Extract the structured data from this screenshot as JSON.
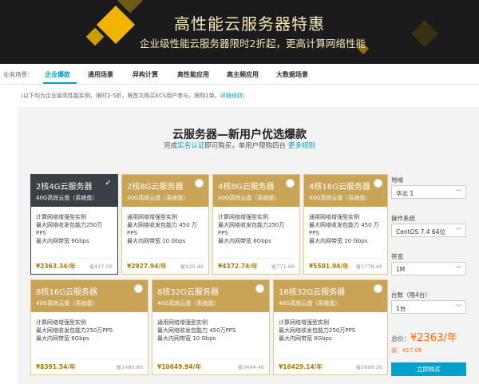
{
  "banner": {
    "title": "高性能云服务器特惠",
    "subtitle": "企业级性能云服务器限时2折起，更高计算网络性能"
  },
  "tabs": {
    "label": "业务场景：",
    "items": [
      {
        "label": "企业爆款",
        "active": true
      },
      {
        "label": "通用场景",
        "active": false
      },
      {
        "label": "异构计算",
        "active": false
      },
      {
        "label": "高性能应用",
        "active": false
      },
      {
        "label": "高主频应用",
        "active": false
      },
      {
        "label": "大数据场景",
        "active": false
      }
    ]
  },
  "note": {
    "text": "（以下均为企业级高性能实例，限时2-5折，限首次购买ECS用户参与，限购1单。",
    "link": "详细规则",
    "close": "）"
  },
  "section": {
    "title": "云服务器—新用户优选爆款",
    "subtitle_pre": "完成",
    "subtitle_link1": "实名认证",
    "subtitle_mid": "即可购买，单用户限购四台",
    "subtitle_link2": "更多规则"
  },
  "cards": [
    {
      "name": "2核4G云服务器",
      "disk": "40G高效云盘（系统盘）",
      "line1": "计算网络增强型实例",
      "line2": "最大网络收发包能力250万",
      "line2b": "PPS",
      "line3": "最大内网带宽 6Gbps",
      "price": "¥2363.34/年",
      "orig": "省417.06",
      "selected": true
    },
    {
      "name": "2核8G云服务器",
      "disk": "40G高效云盘（系统盘）",
      "line1": "通用网络增强型实例",
      "line2": "最大网络收发包能力 450 万",
      "line2b": "PPS",
      "line3": "最大内网带宽 10 Gbps",
      "price": "¥2927.94/年",
      "orig": "省920.46",
      "selected": false
    },
    {
      "name": "4核8G云服务器",
      "disk": "40G高效云盘（系统盘）",
      "line1": "计算网络增强型实例",
      "line2": "最大网络收发包能力250万",
      "line2b": "PPS",
      "line3": "最大内网带宽 6Gbps",
      "price": "¥4372.74/年",
      "orig": "省771.66",
      "selected": false
    },
    {
      "name": "4核16G云服务器",
      "disk": "40G高效云盘（系统盘）",
      "line1": "通用网络增强型实例",
      "line2": "最大网络收发包能力 450 万",
      "line2b": "PPS",
      "line3": "最大内网带宽 10 Gbps",
      "price": "¥5501.94/年",
      "orig": "省1778.46",
      "selected": false
    },
    {
      "name": "8核16G云服务器",
      "disk": "40G高效云盘（系统盘）",
      "line1": "计算网络增强型实例",
      "line2": "最大网络收发包能力250万PPS",
      "line2b": "",
      "line3": "最大内网带宽 6Gbps",
      "price": "¥8391.54/年",
      "orig": "省1480.86",
      "selected": false
    },
    {
      "name": "8核32G云服务器",
      "disk": "40G高效云盘（系统盘）",
      "line1": "通用网络增强型实例",
      "line2": "最大网络收发包能力 450万PPS",
      "line2b": "",
      "line3": "最大内网带宽 10 Gbps",
      "price": "¥10649.94/年",
      "orig": "省3494.46",
      "selected": false
    },
    {
      "name": "16核32G云服务器",
      "disk": "40G高效云盘（系统盘）",
      "line1": "计算网络增强型实例",
      "line2": "最大网络收发包能力250万PPS",
      "line2b": "",
      "line3": "最大内网带宽 6Gbps",
      "price": "¥16429.14/年",
      "orig": "省2899.26",
      "selected": false
    }
  ],
  "sidebar": {
    "region_label": "地域",
    "region_value": "华北 1",
    "os_label": "操作系统",
    "os_value": "CentOS 7.4 64位",
    "bandwidth_label": "带宽",
    "bandwidth_value": "1M",
    "count_label": "台数（限4台）",
    "count_value": "1台",
    "total_label": "总价：",
    "total_value": "¥2363/年",
    "save_text": "省：417.06",
    "buy_label": "立即购买"
  },
  "colors": {
    "accent": "#00a2ca",
    "gold": "#c9a457",
    "selected": "#3b3f46",
    "price": "#ff6a00"
  }
}
